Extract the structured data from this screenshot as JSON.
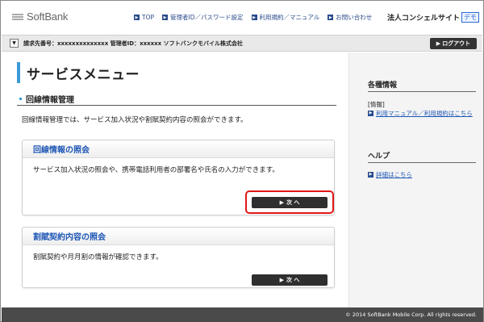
{
  "header": {
    "logo_text": "SoftBank",
    "nav": [
      {
        "label": "TOP"
      },
      {
        "label": "管理者ID／パスワード設定"
      },
      {
        "label": "利用規約／マニュアル"
      },
      {
        "label": "お問い合わせ"
      }
    ],
    "brand": "法人コンシェルサイト",
    "demo_badge": "デモ"
  },
  "account_bar": {
    "toggle_glyph": "▼",
    "info": "請求先番号：xxxxxxxxxxxxxx 管理者ID：xxxxxx ソフトバンクモバイル株式会社",
    "logout_label": "ログアウト",
    "logout_arrow": "▶"
  },
  "main": {
    "page_title": "サービスメニュー",
    "section_title": "回線情報管理",
    "section_desc": "回線情報管理では、サービス加入状況や割賦契約内容の照会ができます。",
    "cards": [
      {
        "title": "回線情報の照会",
        "body": "サービス加入状況の照会や、携帯電話利用者の部署名や氏名の入力ができます。",
        "button_label": "次 へ",
        "button_arrow": "▶"
      },
      {
        "title": "割賦契約内容の照会",
        "body": "割賦契約や月月割の情報が確認できます。",
        "button_label": "次 へ",
        "button_arrow": "▶"
      }
    ]
  },
  "sidebar": {
    "info_heading": "各種情報",
    "info_sub": "[情報]",
    "info_link": "利用マニュアル／利用規約はこちら",
    "help_heading": "ヘルプ",
    "help_link": "詳細はこちら"
  },
  "footer": {
    "copyright": "© 2014 SoftBank Mobile Corp. All rights reserved."
  },
  "colors": {
    "accent": "#3b9bd6",
    "link": "#1f57b5",
    "highlight": "#e01818"
  }
}
